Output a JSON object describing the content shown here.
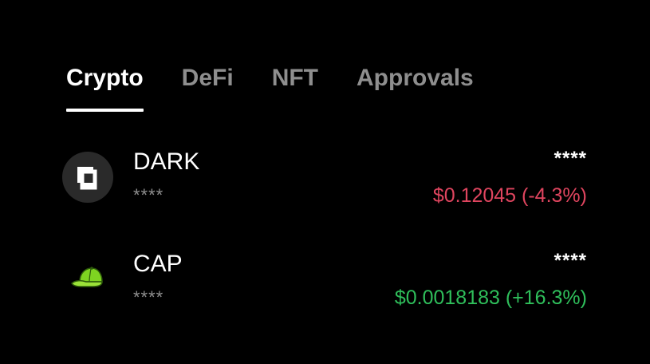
{
  "tabs": [
    {
      "label": "Crypto",
      "active": true
    },
    {
      "label": "DeFi",
      "active": false
    },
    {
      "label": "NFT",
      "active": false
    },
    {
      "label": "Approvals",
      "active": false
    }
  ],
  "assets": [
    {
      "name": "DARK",
      "icon": "dark-token-icon",
      "balance_masked": "****",
      "value_masked": "****",
      "price_change": "$0.12045 (-4.3%)",
      "trend": "negative",
      "trend_color": "#e0455f"
    },
    {
      "name": "CAP",
      "icon": "cap-token-icon",
      "balance_masked": "****",
      "value_masked": "****",
      "price_change": "$0.0018183 (+16.3%)",
      "trend": "positive",
      "trend_color": "#2fbf5b"
    }
  ],
  "colors": {
    "background": "#000000",
    "active_tab": "#ffffff",
    "inactive_tab": "#8e8e8e",
    "negative": "#e0455f",
    "positive": "#2fbf5b"
  }
}
